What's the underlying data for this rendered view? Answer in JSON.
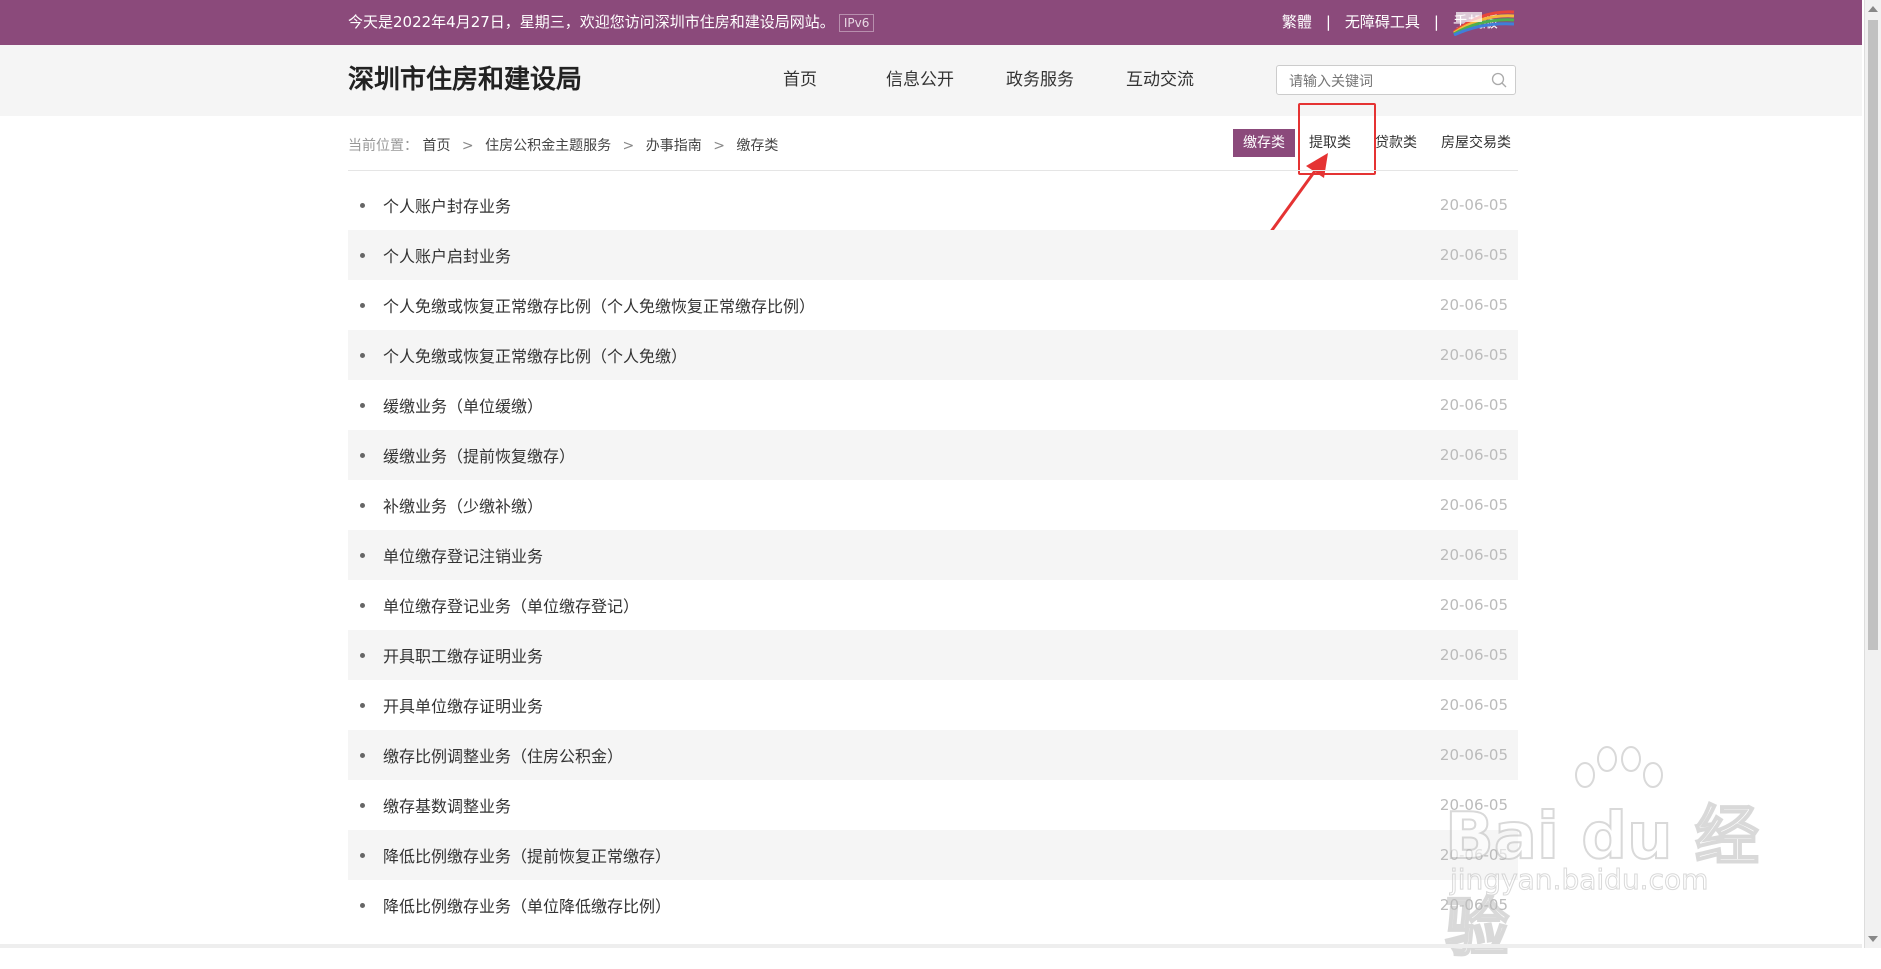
{
  "topbar": {
    "welcome": "今天是2022年4月27日，星期三，欢迎您访问深圳市住房和建设局网站。",
    "ipv6": "IPv6",
    "links": [
      "繁體",
      "无障碍工具",
      "手机版"
    ],
    "separator": "|"
  },
  "header": {
    "title": "深圳市住房和建设局",
    "nav": [
      "首页",
      "信息公开",
      "政务服务",
      "互动交流"
    ],
    "search_placeholder": "请输入关键词"
  },
  "breadcrumb": {
    "label": "当前位置：",
    "items": [
      "首页",
      "住房公积金主题服务",
      "办事指南",
      "缴存类"
    ],
    "arrow": ">"
  },
  "tabs": [
    "缴存类",
    "提取类",
    "贷款类",
    "房屋交易类"
  ],
  "list": [
    {
      "title": "个人账户封存业务",
      "date": "20-06-05"
    },
    {
      "title": "个人账户启封业务",
      "date": "20-06-05"
    },
    {
      "title": "个人免缴或恢复正常缴存比例（个人免缴恢复正常缴存比例）",
      "date": "20-06-05"
    },
    {
      "title": "个人免缴或恢复正常缴存比例（个人免缴）",
      "date": "20-06-05"
    },
    {
      "title": "缓缴业务（单位缓缴）",
      "date": "20-06-05"
    },
    {
      "title": "缓缴业务（提前恢复缴存）",
      "date": "20-06-05"
    },
    {
      "title": "补缴业务（少缴补缴）",
      "date": "20-06-05"
    },
    {
      "title": "单位缴存登记注销业务",
      "date": "20-06-05"
    },
    {
      "title": "单位缴存登记业务（单位缴存登记）",
      "date": "20-06-05"
    },
    {
      "title": "开具职工缴存证明业务",
      "date": "20-06-05"
    },
    {
      "title": "开具单位缴存证明业务",
      "date": "20-06-05"
    },
    {
      "title": "缴存比例调整业务（住房公积金）",
      "date": "20-06-05"
    },
    {
      "title": "缴存基数调整业务",
      "date": "20-06-05"
    },
    {
      "title": "降低比例缴存业务（提前恢复正常缴存）",
      "date": "20-06-05"
    },
    {
      "title": "降低比例缴存业务（单位降低缴存比例）",
      "date": "20-06-05"
    }
  ],
  "watermark": {
    "brand": "Bai du 经验",
    "url": "jingyan.baidu.com"
  },
  "colors": {
    "brand": "#8b4a7b",
    "annotation": "#e53333"
  }
}
